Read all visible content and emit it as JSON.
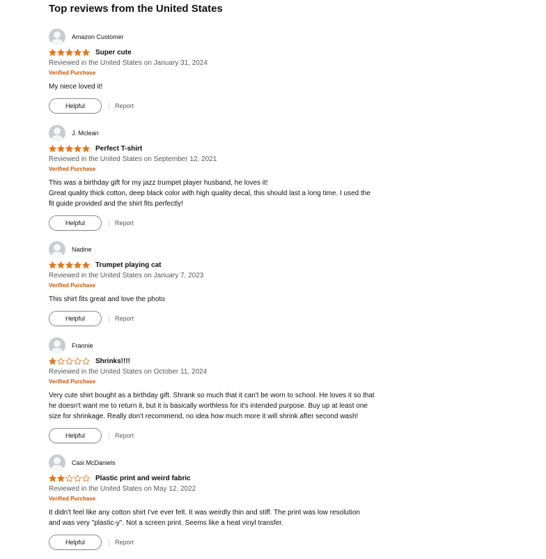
{
  "section_title": "Top reviews from the United States",
  "colors": {
    "star_fill": "#de7921",
    "star_outline": "#de7921",
    "verified": "#c45500",
    "date": "#565959"
  },
  "icons": {
    "avatar": "default-profile-avatar-icon",
    "star_full": "star-filled-icon",
    "star_empty": "star-outline-icon"
  },
  "reviews": [
    {
      "name": "Amazon Customer",
      "rating": 5,
      "title": "Super cute",
      "date": "Reviewed in the United States on January 31, 2024",
      "verified": "Verified Purchase",
      "body": [
        "My niece loved it!"
      ],
      "helpful": "Helpful",
      "report": "Report"
    },
    {
      "name": "J. Mclean",
      "rating": 5,
      "title": "Perfect T-shirt",
      "date": "Reviewed in the United States on September 12, 2021",
      "verified": "Verified Purchase",
      "body": [
        "This was a birthday gift for my jazz trumpet player husband, he loves it!",
        "Great quality thick cotton, deep black color with high quality decal, this should last a long time. I used the",
        "fit guide provided and the shirt fits perfectly!"
      ],
      "helpful": "Helpful",
      "report": "Report"
    },
    {
      "name": "Nadine",
      "rating": 5,
      "title": "Trumpet playing cat",
      "date": "Reviewed in the United States on January 7, 2023",
      "verified": "Verified Purchase",
      "body": [
        "This shirt fits great and love the photo"
      ],
      "helpful": "Helpful",
      "report": "Report"
    },
    {
      "name": "Frannie",
      "rating": 1,
      "title": "Shrinks!!!!",
      "date": "Reviewed in the United States on October 11, 2024",
      "verified": "Verified Purchase",
      "body": [
        "Very cute shirt bought as a birthday gift. Shrank so much that it can't be worn to school. He loves it so that",
        "he doesn't want me to return it, but it is basically worthless for it's intended purpose. Buy up at least one",
        "size for shrinkage. Really don't recommend, no idea how much more it will shrink after second wash!"
      ],
      "helpful": "Helpful",
      "report": "Report"
    },
    {
      "name": "Casi McDaniels",
      "rating": 2,
      "title": "Plastic print and weird fabric",
      "date": "Reviewed in the United States on May 12, 2022",
      "verified": "Verified Purchase",
      "body": [
        "It didn't feel like any cotton shirt I've ever felt. It was weirdly thin and stiff. The print was low resolution",
        "and was very \"plastic-y\". Not a screen print. Seems like a heat vinyl transfer."
      ],
      "helpful": "Helpful",
      "report": "Report"
    }
  ]
}
